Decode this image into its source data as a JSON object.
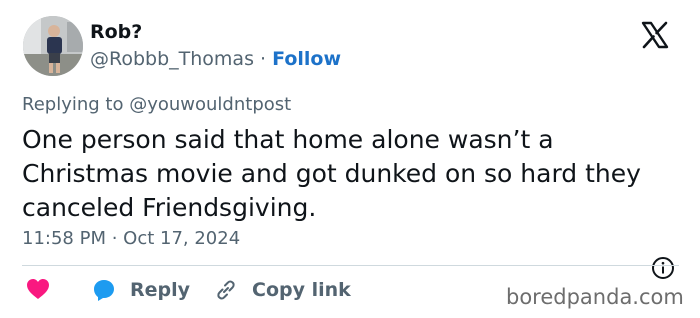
{
  "author": {
    "name": "Rob?",
    "handle": "@Robbb_Thomas",
    "separator": "·",
    "follow_label": "Follow"
  },
  "reply_context": {
    "prefix": "Replying to",
    "handle": "@youwouldntpost"
  },
  "tweet": {
    "text": "One person said that home alone wasn’t a Christmas movie and got dunked on so hard they canceled Friendsgiving.",
    "timestamp": "11:58 PM · Oct 17, 2024"
  },
  "actions": {
    "reply_label": "Reply",
    "copy_link_label": "Copy link"
  },
  "watermark": "boredpanda.com",
  "colors": {
    "like": "#f91880",
    "reply": "#1d9bf0",
    "follow": "#1d72c9",
    "secondary_text": "#536471"
  },
  "icons": [
    "x-logo-icon",
    "heart-icon",
    "speech-bubble-icon",
    "link-icon",
    "info-icon"
  ]
}
